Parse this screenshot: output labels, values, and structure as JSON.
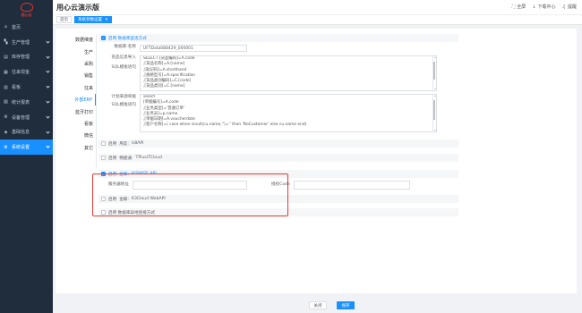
{
  "app": {
    "title": "用心云演示版",
    "logo_text": "用心云"
  },
  "header": {
    "actions": [
      {
        "icon": "fullscreen-icon",
        "glyph": "⛶",
        "label": "全屏"
      },
      {
        "icon": "download-icon",
        "glyph": "↓",
        "label": "下载中心"
      },
      {
        "icon": "bell-icon",
        "glyph": "♫",
        "label": "提醒"
      }
    ]
  },
  "sidebar": {
    "items": [
      {
        "label": "首页",
        "icon": "home-icon",
        "glyph": "⌂"
      },
      {
        "label": "生产管理",
        "icon": "production-icon",
        "glyph": "▚"
      },
      {
        "label": "库存管理",
        "icon": "inventory-icon",
        "glyph": "▤"
      },
      {
        "label": "往来现金",
        "icon": "cash-icon",
        "glyph": "▦"
      },
      {
        "label": "看板",
        "icon": "dashboard-icon",
        "glyph": "▥"
      },
      {
        "label": "统计报表",
        "icon": "report-icon",
        "glyph": "▧"
      },
      {
        "label": "设备管理",
        "icon": "device-icon",
        "glyph": "⚙"
      },
      {
        "label": "基础信息",
        "icon": "basic-info-icon",
        "glyph": "◈"
      },
      {
        "label": "系统设置",
        "icon": "settings-icon",
        "glyph": "⚙",
        "active": true
      }
    ]
  },
  "tabs": [
    {
      "label": "首页"
    },
    {
      "label": "系统参数设置",
      "active": true,
      "close": "✕"
    }
  ],
  "left_menu": [
    "数据维度",
    "生产",
    "采购",
    "销售",
    "往来",
    "外部ERP",
    "蓝牙打印",
    "看板",
    "微信",
    "其它"
  ],
  "left_menu_active": 5,
  "sections": {
    "db_mode": {
      "label": "启用 数据库直连方式",
      "account_label": "数据库:名称",
      "account_value": "UFTData088429_000001",
      "import_label_1": "货品信息导入",
      "import_label_2": "SQL模板语句",
      "import_sql": [
        "SELECT  [货品编码]=A.code",
        ",[货品名称]=A.[name]",
        ",[助记码]=A.shorthand",
        ",[规格型号]=A.specification",
        ",[货品类别编码]=C.[code]",
        ",[货品类别]=C.[name]"
      ],
      "plan_label_1": "计划来源单据",
      "plan_label_2": "SQL模板语句",
      "plan_sql": [
        "select",
        " [单据编号]=A.code",
        ",[业务类型]='普通订单'",
        ",[业务员]=p.name",
        ",[单据日期]=A.voucherdate",
        ",[客户名称]=( case when isnull(cu.name,'')='' then 'NoCustomer' else cu.name end)"
      ]
    },
    "yonyou_u8": {
      "prefix": "启用",
      "vendor": "用友:",
      "product": "U8API"
    },
    "chanjet_t": {
      "prefix": "启用",
      "vendor": "畅捷通:",
      "product": "TPlus/TCloud"
    },
    "kingdee_kis": {
      "prefix": "启用",
      "vendor": "金蝶:",
      "product": "KISWISE API",
      "server_label": "服务器地址",
      "server_value": "",
      "auth_label": "授权Code",
      "auth_value": ""
    },
    "kingdee_k3": {
      "prefix": "启用",
      "vendor": "金蝶:",
      "product": "K3Cloud WebAPI"
    },
    "db_other": {
      "label": "启用 数据库异地连接方式"
    }
  },
  "footer": {
    "close_label": "关闭",
    "save_label": "保存"
  },
  "colors": {
    "primary": "#1890ff",
    "sidebar_bg": "#1f2d3d",
    "highlight": "#e53935"
  }
}
